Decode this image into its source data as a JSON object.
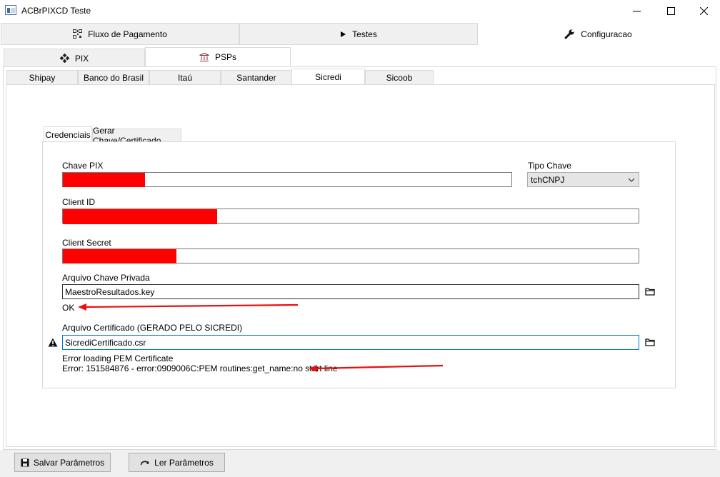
{
  "window": {
    "title": "ACBrPIXCD Teste",
    "minimize_icon": "minimize-icon",
    "maximize_icon": "maximize-icon",
    "close_icon": "close-icon"
  },
  "main_tabs": [
    {
      "label": "Fluxo de Pagamento",
      "icon": "qr-code-icon",
      "active": false
    },
    {
      "label": "Testes",
      "icon": "play-icon",
      "active": false
    },
    {
      "label": "Configuracao",
      "icon": "wrench-icon",
      "active": true
    }
  ],
  "config_tabs": [
    {
      "label": "PIX",
      "icon": "pix-icon",
      "active": false
    },
    {
      "label": "PSPs",
      "icon": "bank-icon",
      "active": true
    }
  ],
  "psp_tabs": [
    {
      "label": "Shipay",
      "active": false
    },
    {
      "label": "Banco do Brasil",
      "active": false
    },
    {
      "label": "Itaú",
      "active": false
    },
    {
      "label": "Santander",
      "active": false
    },
    {
      "label": "Sicredi",
      "active": true
    },
    {
      "label": "Sicoob",
      "active": false
    }
  ],
  "inner_tabs": [
    {
      "label": "Credenciais",
      "active": true
    },
    {
      "label": "Gerar Chave/Certificado",
      "active": false
    }
  ],
  "form": {
    "chave_pix_label": "Chave PIX",
    "chave_pix_value": "",
    "tipo_chave_label": "Tipo Chave",
    "tipo_chave_value": "tchCNPJ",
    "client_id_label": "Client ID",
    "client_id_value": "",
    "client_secret_label": "Client Secret",
    "client_secret_value": "",
    "chave_privada_label": "Arquivo Chave Privada",
    "chave_privada_value": "MaestroResultados.key",
    "chave_privada_status": "OK",
    "certificado_label": "Arquivo Certificado (GERADO PELO SICREDI)",
    "certificado_value": "SicrediCertificado.csr",
    "certificado_error_title": "Error loading PEM Certificate",
    "certificado_error_detail": "Error: 151584876 - error:0909006C:PEM routines:get_name:no start line"
  },
  "footer": {
    "save_label": "Salvar Parâmetros",
    "read_label": "Ler Parâmetros"
  },
  "colors": {
    "redaction": "#ff0000",
    "annotation_arrow": "#e81010",
    "focus_border": "#0078d7"
  }
}
